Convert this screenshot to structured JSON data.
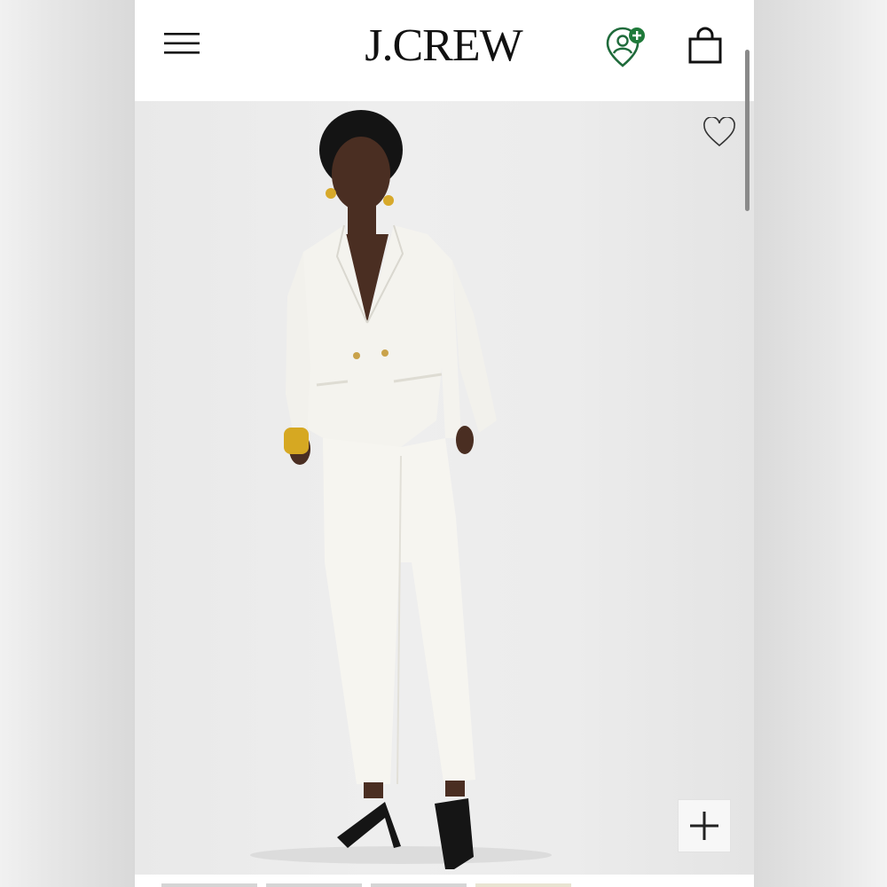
{
  "header": {
    "logo_text": "J.CREW",
    "menu_icon": "hamburger-menu-icon",
    "account_icon": "account-location-plus-icon",
    "bag_icon": "shopping-bag-icon",
    "account_badge_color": "#1f7a3a"
  },
  "product": {
    "wishlist_icon": "heart-outline-icon",
    "zoom_icon": "plus-icon",
    "background_color": "#ececec"
  },
  "thumbnails": {
    "count": 4
  }
}
